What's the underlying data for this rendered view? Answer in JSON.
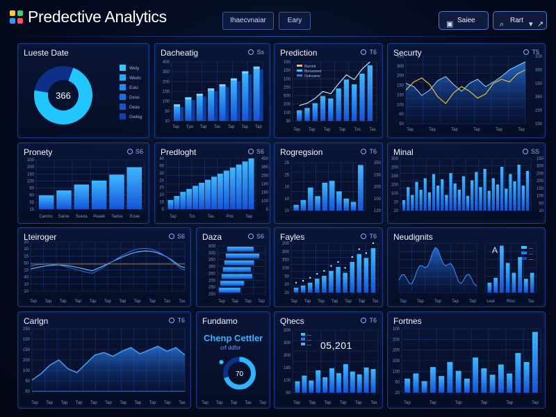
{
  "app": {
    "title": "Predective Analytics"
  },
  "header": {
    "btn1": "Ihaecvnaiar",
    "btn2": "Eary",
    "save": "Saiee",
    "user": "Rart"
  },
  "colors": {
    "bar": "#1f7bff",
    "barLight": "#38b6ff",
    "line": "#8fc8ff",
    "accent": "#e8c23a"
  },
  "panels": [
    {
      "key": "leads",
      "title": "Lueste Date",
      "ctl": "",
      "type": "donut",
      "center": "366",
      "value_pct": 72,
      "legend": [
        "Wely",
        "Wedo",
        "Eolo",
        "Dvos",
        "Deas",
        "Gwleg"
      ]
    },
    {
      "key": "dashboard",
      "title": "Dacheatig",
      "ctl": "Ss",
      "type": "bar3d",
      "yticks": [
        "400",
        "350",
        "200",
        "150",
        "100",
        "50",
        "10"
      ],
      "xticks": [
        "Tap",
        "Tpo",
        "Tap",
        "Tas",
        "Tap",
        "Tap",
        "Tap"
      ],
      "values": [
        28,
        40,
        46,
        55,
        62,
        72,
        84,
        92
      ]
    },
    {
      "key": "prediction",
      "title": "Prediction",
      "ctl": "T6",
      "type": "barline",
      "legend": [
        "Rurrieit",
        "Bonurneen",
        "Outnowne"
      ],
      "yticks": [
        "150",
        "150",
        "100",
        "250",
        "500",
        "200",
        "100",
        "30"
      ],
      "xticks": [
        "Tap",
        "Tap",
        "Tap",
        "Tap",
        "Tos",
        "Tas"
      ],
      "values": [
        18,
        22,
        30,
        42,
        38,
        55,
        70,
        62,
        80,
        94
      ]
    },
    {
      "key": "security",
      "title": "Securty",
      "ctl": "T5",
      "type": "area",
      "yticks": [
        "420",
        "300",
        "200",
        "150",
        "150",
        "100",
        "60",
        "50"
      ],
      "ryticks": [
        "100",
        "350",
        "150",
        "360",
        "150",
        "150"
      ],
      "xticks": [
        "Tap",
        "Tap",
        "Tap",
        "Tap",
        "Tap",
        "Tap"
      ]
    },
    {
      "key": "priority",
      "title": "Pronety",
      "ctl": "S6",
      "type": "bars",
      "yticks": [
        "200",
        "200",
        "150",
        "100",
        "50",
        "60",
        "55",
        "15"
      ],
      "xticks": [
        "Canmo",
        "Saroe",
        "Sveoa",
        "Peaek",
        "Tadoa",
        "Eoae"
      ],
      "values": [
        28,
        38,
        50,
        58,
        70,
        85
      ]
    },
    {
      "key": "predlight",
      "title": "Predloght",
      "ctl": "S6",
      "type": "stair",
      "yticks": [
        "40",
        "50",
        "20",
        "20",
        "20",
        "10",
        "15",
        "5"
      ],
      "ryticks": [
        "450",
        "360",
        "250",
        "180",
        "180",
        "100",
        "5"
      ],
      "xticks": [
        "Tap",
        "Tos",
        "Tas",
        "Pos",
        "Tap"
      ],
      "values": [
        18,
        26,
        34,
        40,
        46,
        52,
        58,
        64,
        70,
        76,
        82,
        88,
        94,
        100
      ]
    },
    {
      "key": "regression",
      "title": "Rogregsion",
      "ctl": "T6",
      "type": "bars2",
      "yticks": [
        "25",
        "25",
        "10",
        "10",
        "10"
      ],
      "ryticks": [
        "250",
        "150",
        "200",
        "100",
        "120"
      ],
      "values": [
        12,
        22,
        48,
        30,
        58,
        62,
        40,
        25,
        18,
        95
      ]
    },
    {
      "key": "minal",
      "title": "Minal",
      "ctl": "SS",
      "type": "manybars",
      "yticks": [
        "300",
        "200",
        "150",
        "200",
        "100",
        "10",
        "20"
      ],
      "ryticks": [
        "150",
        "300",
        "200",
        "200",
        "150",
        "100",
        "50",
        "10"
      ],
      "values": [
        20,
        45,
        30,
        55,
        40,
        62,
        35,
        70,
        48,
        60,
        30,
        72,
        52,
        40,
        66,
        28,
        58,
        74,
        45,
        80,
        38,
        62,
        50,
        84,
        42,
        70,
        56,
        88,
        48,
        76
      ]
    },
    {
      "key": "latencies",
      "title": "Lteiroger",
      "ctl": "S6",
      "type": "wave",
      "yticks": [
        "20",
        "10",
        "15",
        "50",
        "10",
        "40",
        "10",
        "10"
      ],
      "xticks": [
        "Tap",
        "Tap",
        "Tap",
        "Tap",
        "Tap",
        "Tap",
        "Tap",
        "Tap",
        "Tap",
        "Tas",
        "Tas"
      ]
    },
    {
      "key": "data",
      "title": "Daza",
      "ctl": "S6",
      "type": "hbars",
      "yticks": [
        "800",
        "300",
        "350",
        "350",
        "350",
        "200",
        "250",
        "250"
      ],
      "xticks": [
        "Tap",
        "Tap",
        "Tap",
        "Tap"
      ],
      "values": [
        55,
        70,
        62,
        58,
        64,
        50,
        45
      ]
    },
    {
      "key": "fayles",
      "title": "Fayles",
      "ctl": "T6",
      "type": "barscatter",
      "yticks": [
        "200",
        "300",
        "350",
        "100",
        "50",
        "20",
        "20"
      ],
      "xticks": [
        "Tap",
        "Tap",
        "Tap",
        "Tap",
        "Tap",
        "Tap",
        "Tas"
      ],
      "values": [
        10,
        14,
        20,
        28,
        34,
        44,
        52,
        40,
        62,
        78,
        70,
        90
      ]
    },
    {
      "key": "newdigits",
      "title": "Neudignits",
      "ctl": "",
      "type": "spike",
      "yticks": [
        "100",
        "350",
        "200",
        "200",
        "100",
        "50",
        "10"
      ],
      "xticks": [
        "Tap",
        "Tap",
        "Tap",
        "Tap",
        "Tap"
      ],
      "xticks2": [
        "Leal",
        "Rlos",
        "Tas"
      ],
      "inset_label": "A",
      "inset_legend": [
        "—",
        "—",
        "—"
      ],
      "values": [
        20,
        30,
        95,
        60,
        40,
        72,
        28,
        40
      ]
    },
    {
      "key": "cartgn",
      "title": "Carlgn",
      "ctl": "T6",
      "type": "blueline",
      "yticks": [
        "250",
        "150",
        "150",
        "200",
        "100",
        "50",
        "50"
      ],
      "xticks": [
        "Tap",
        "Tap",
        "Tap",
        "Tap",
        "Tap",
        "Tap",
        "Tap",
        "Tap",
        "Tap",
        "Tap",
        "Tas"
      ]
    },
    {
      "key": "fundame",
      "title": "Fundamo",
      "ctl": "",
      "type": "gauge",
      "big": "Chenp Cettler",
      "sub": "crf ddfor",
      "value": "70",
      "value_pct": 70,
      "xticks": [
        "Tap",
        "Tap",
        "Tap",
        "Tas",
        "Tap"
      ]
    },
    {
      "key": "checks",
      "title": "Qhecs",
      "ctl": "T6",
      "type": "counter",
      "counter": "05,201",
      "legend": [
        "—",
        "—",
        "—"
      ],
      "yticks": [
        "200",
        "300",
        "200",
        "180",
        "100",
        "50"
      ],
      "xticks": [
        "Tap",
        "Tap",
        "Tap",
        "Tap",
        "Tap",
        "Tas"
      ],
      "values": [
        28,
        42,
        30,
        55,
        38,
        60,
        48,
        70,
        52,
        45,
        62,
        58
      ]
    },
    {
      "key": "features",
      "title": "Fortnes",
      "ctl": "",
      "type": "finalbars",
      "yticks": [
        "100",
        "200",
        "200",
        "200",
        "100",
        "50",
        "20"
      ],
      "xticks": [
        "Tap",
        "Tap",
        "Tap",
        "Tap",
        "Tap",
        "Tap"
      ],
      "values": [
        22,
        30,
        18,
        40,
        26,
        48,
        34,
        22,
        55,
        38,
        28,
        44,
        30,
        62,
        48,
        95
      ]
    }
  ]
}
